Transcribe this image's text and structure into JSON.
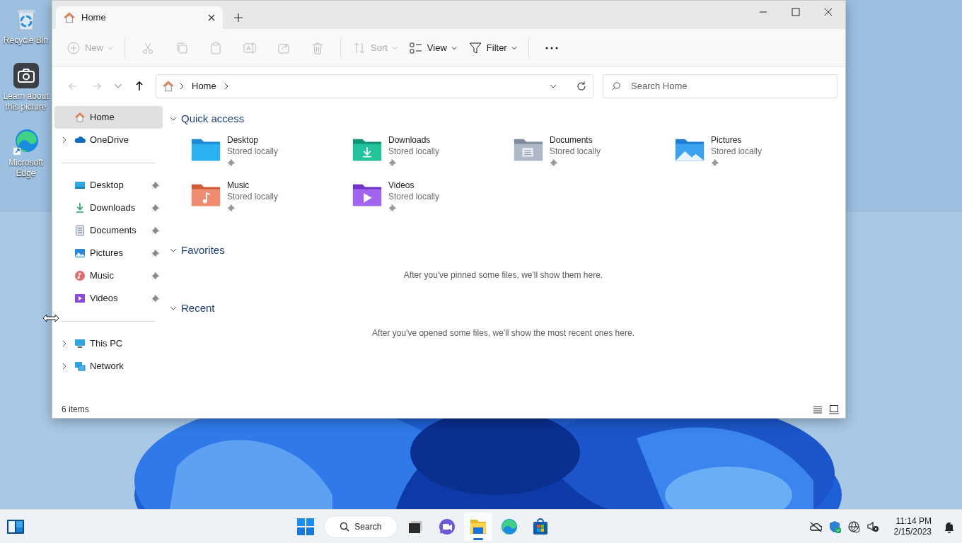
{
  "desktop_icons": [
    {
      "kind": "recycle",
      "label": "Recycle Bin"
    },
    {
      "kind": "camera",
      "label": "Learn about this picture"
    },
    {
      "kind": "edge",
      "label": "Microsoft Edge"
    }
  ],
  "window": {
    "tabs": [
      {
        "label": "Home",
        "selected": true
      }
    ],
    "toolbar": [
      [
        {
          "kind": "new",
          "label": "New",
          "disabled": true,
          "dropdown": true
        }
      ],
      [
        {
          "kind": "cut",
          "disabled": true
        },
        {
          "kind": "copy",
          "disabled": true
        },
        {
          "kind": "paste",
          "disabled": true
        },
        {
          "kind": "rename",
          "disabled": true
        },
        {
          "kind": "share",
          "disabled": true
        },
        {
          "kind": "delete",
          "disabled": true
        }
      ],
      [
        {
          "kind": "sort",
          "label": "Sort",
          "disabled": true,
          "dropdown": true
        },
        {
          "kind": "view",
          "label": "View",
          "disabled": false,
          "dropdown": true
        },
        {
          "kind": "filter",
          "label": "Filter",
          "disabled": false,
          "dropdown": true
        }
      ],
      [
        {
          "kind": "more",
          "disabled": false
        }
      ]
    ],
    "nav_buttons": [
      {
        "kind": "back",
        "disabled": true
      },
      {
        "kind": "forward",
        "disabled": true
      },
      {
        "kind": "up",
        "disabled": false
      }
    ],
    "address": {
      "path": [
        "Home"
      ]
    },
    "search": {
      "placeholder": "Search Home"
    },
    "sidebar": [
      [
        {
          "kind": "home",
          "label": "Home",
          "selected": true,
          "expandable": false,
          "pinned": false
        },
        {
          "kind": "onedrive",
          "label": "OneDrive",
          "selected": false,
          "expandable": true,
          "pinned": false
        }
      ],
      [
        {
          "kind": "desktop",
          "label": "Desktop",
          "selected": false,
          "expandable": false,
          "pinned": true
        },
        {
          "kind": "downloads",
          "label": "Downloads",
          "selected": false,
          "expandable": false,
          "pinned": true
        },
        {
          "kind": "documents",
          "label": "Documents",
          "selected": false,
          "expandable": false,
          "pinned": true
        },
        {
          "kind": "pictures",
          "label": "Pictures",
          "selected": false,
          "expandable": false,
          "pinned": true
        },
        {
          "kind": "music",
          "label": "Music",
          "selected": false,
          "expandable": false,
          "pinned": true
        },
        {
          "kind": "videos",
          "label": "Videos",
          "selected": false,
          "expandable": false,
          "pinned": true
        }
      ],
      [
        {
          "kind": "thispc",
          "label": "This PC",
          "selected": false,
          "expandable": true,
          "pinned": false
        },
        {
          "kind": "network",
          "label": "Network",
          "selected": false,
          "expandable": true,
          "pinned": false
        }
      ]
    ],
    "sections": [
      {
        "title": "Quick access",
        "expanded": true,
        "items": [
          {
            "kind": "desktop",
            "name": "Desktop",
            "detail": "Stored locally",
            "pinned": true
          },
          {
            "kind": "downloads",
            "name": "Downloads",
            "detail": "Stored locally",
            "pinned": true
          },
          {
            "kind": "documents",
            "name": "Documents",
            "detail": "Stored locally",
            "pinned": true
          },
          {
            "kind": "pictures",
            "name": "Pictures",
            "detail": "Stored locally",
            "pinned": true
          },
          {
            "kind": "music",
            "name": "Music",
            "detail": "Stored locally",
            "pinned": true
          },
          {
            "kind": "videos",
            "name": "Videos",
            "detail": "Stored locally",
            "pinned": true
          }
        ]
      },
      {
        "title": "Favorites",
        "expanded": true,
        "message": "After you've pinned some files, we'll show them here."
      },
      {
        "title": "Recent",
        "expanded": true,
        "message": "After you've opened some files, we'll show the most recent ones here."
      }
    ],
    "status_bar": {
      "count": "6 items"
    }
  },
  "taskbar": {
    "apps": [
      {
        "kind": "start",
        "selected": false
      },
      {
        "kind": "search",
        "label": "Search",
        "selected": false
      },
      {
        "kind": "taskview",
        "selected": false
      },
      {
        "kind": "chat",
        "selected": false
      },
      {
        "kind": "explorer",
        "selected": true
      },
      {
        "kind": "edge",
        "selected": false
      },
      {
        "kind": "store",
        "selected": false
      }
    ],
    "tray": [
      {
        "kind": "cloud-off"
      },
      {
        "kind": "shield"
      },
      {
        "kind": "globe"
      },
      {
        "kind": "mute"
      }
    ],
    "time": "11:14 PM",
    "date": "2/15/2023"
  }
}
